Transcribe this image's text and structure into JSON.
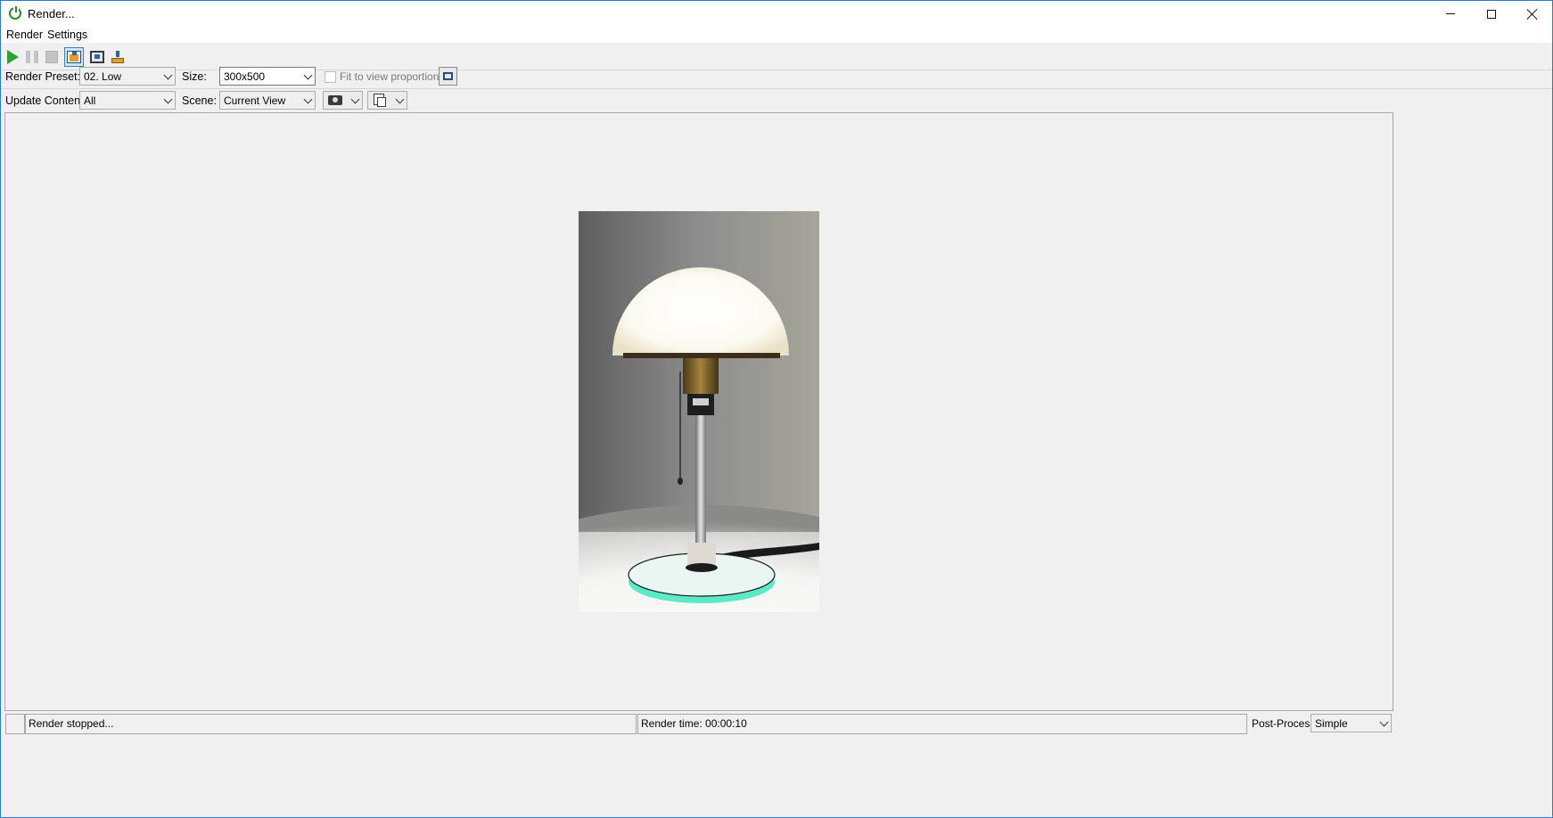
{
  "window": {
    "title": "Render..."
  },
  "menu": {
    "items": [
      "Render",
      "Settings"
    ]
  },
  "toolbar": {
    "buttons": [
      {
        "name": "play-icon"
      },
      {
        "name": "pause-icon"
      },
      {
        "name": "stop-icon"
      },
      {
        "name": "render-to-image-icon"
      },
      {
        "name": "render-to-window-icon"
      },
      {
        "name": "save-render-icon"
      }
    ]
  },
  "options": {
    "render_preset_label": "Render Preset:",
    "render_preset_value": "02. Low",
    "size_label": "Size:",
    "size_value": "300x500",
    "fit_label": "Fit to view proportions",
    "update_content_label": "Update Content:",
    "update_content_value": "All",
    "scene_label": "Scene:",
    "scene_value": "Current View"
  },
  "status": {
    "message": "Render stopped...",
    "render_time": "Render time: 00:00:10",
    "post_process_label": "Post-Process:",
    "post_process_value": "Simple"
  },
  "colors": {
    "accent": "#2b7bd3",
    "play_green": "#2fa12f",
    "glass_base": "#3ee8c0"
  }
}
